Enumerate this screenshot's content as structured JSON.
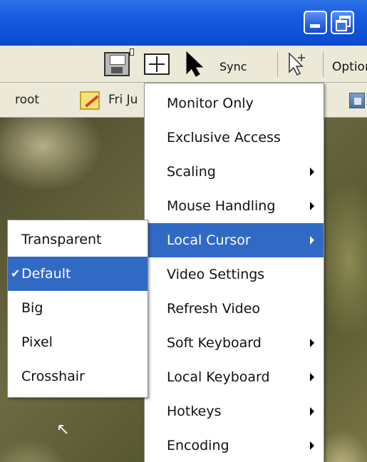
{
  "toolbar": {
    "sync_label": "Sync",
    "options_label": "Options"
  },
  "statusbar": {
    "user": "root",
    "date": "Fri Ju"
  },
  "main_menu": {
    "items": [
      {
        "label": "Monitor Only",
        "submenu": false
      },
      {
        "label": "Exclusive Access",
        "submenu": false
      },
      {
        "label": "Scaling",
        "submenu": true
      },
      {
        "label": "Mouse Handling",
        "submenu": true
      },
      {
        "label": "Local Cursor",
        "submenu": true,
        "selected": true
      },
      {
        "label": "Video Settings",
        "submenu": false
      },
      {
        "label": "Refresh Video",
        "submenu": false
      },
      {
        "label": "Soft Keyboard",
        "submenu": true
      },
      {
        "label": "Local Keyboard",
        "submenu": true
      },
      {
        "label": "Hotkeys",
        "submenu": true
      },
      {
        "label": "Encoding",
        "submenu": true
      }
    ]
  },
  "cursor_submenu": {
    "items": [
      {
        "label": "Transparent"
      },
      {
        "label": "Default",
        "checked": true,
        "selected": true
      },
      {
        "label": "Big"
      },
      {
        "label": "Pixel"
      },
      {
        "label": "Crosshair"
      }
    ]
  },
  "colors": {
    "titlebar": "#0c4fd6",
    "selection": "#316ac5",
    "toolbar": "#ece9d8"
  },
  "icons": [
    "minimize-icon",
    "restore-icon",
    "save-icon",
    "fit-screen-icon",
    "arrow-cursor-icon",
    "outline-cursor-icon",
    "note-icon",
    "network-icon",
    "checkmark-icon",
    "submenu-arrow-icon"
  ]
}
